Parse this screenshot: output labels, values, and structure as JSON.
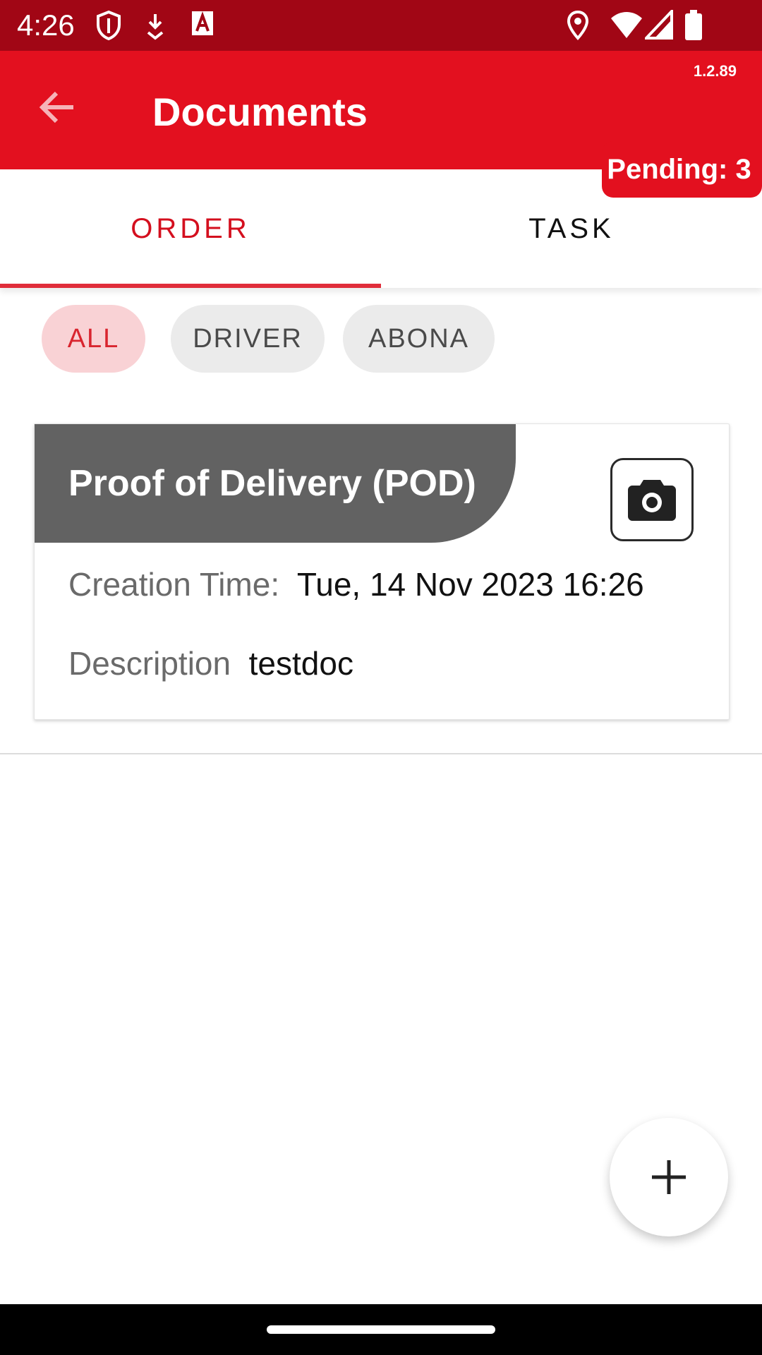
{
  "status_bar": {
    "time": "4:26",
    "left_icons": [
      "shield-icon",
      "download-icon",
      "text-a-icon"
    ],
    "right_icons": [
      "location-icon",
      "wifi-icon",
      "signal-icon",
      "battery-icon"
    ]
  },
  "app_bar": {
    "title": "Documents",
    "version": "1.2.89",
    "back_icon": "arrow-back-icon",
    "pending": "Pending: 3",
    "color": "#e3101f"
  },
  "tabs": [
    {
      "label": "ORDER",
      "selected": true
    },
    {
      "label": "TASK",
      "selected": false
    }
  ],
  "filters": [
    {
      "label": "ALL",
      "selected": true
    },
    {
      "label": "DRIVER",
      "selected": false
    },
    {
      "label": "ABONA",
      "selected": false
    }
  ],
  "documents": [
    {
      "title": "Proof of Delivery (POD)",
      "creation_time_label": "Creation Time:",
      "creation_time": "Tue, 14 Nov 2023 16:26",
      "description_label": "Description",
      "description": "testdoc",
      "action_icon": "camera-icon"
    }
  ],
  "fab": {
    "icon": "plus-icon"
  }
}
